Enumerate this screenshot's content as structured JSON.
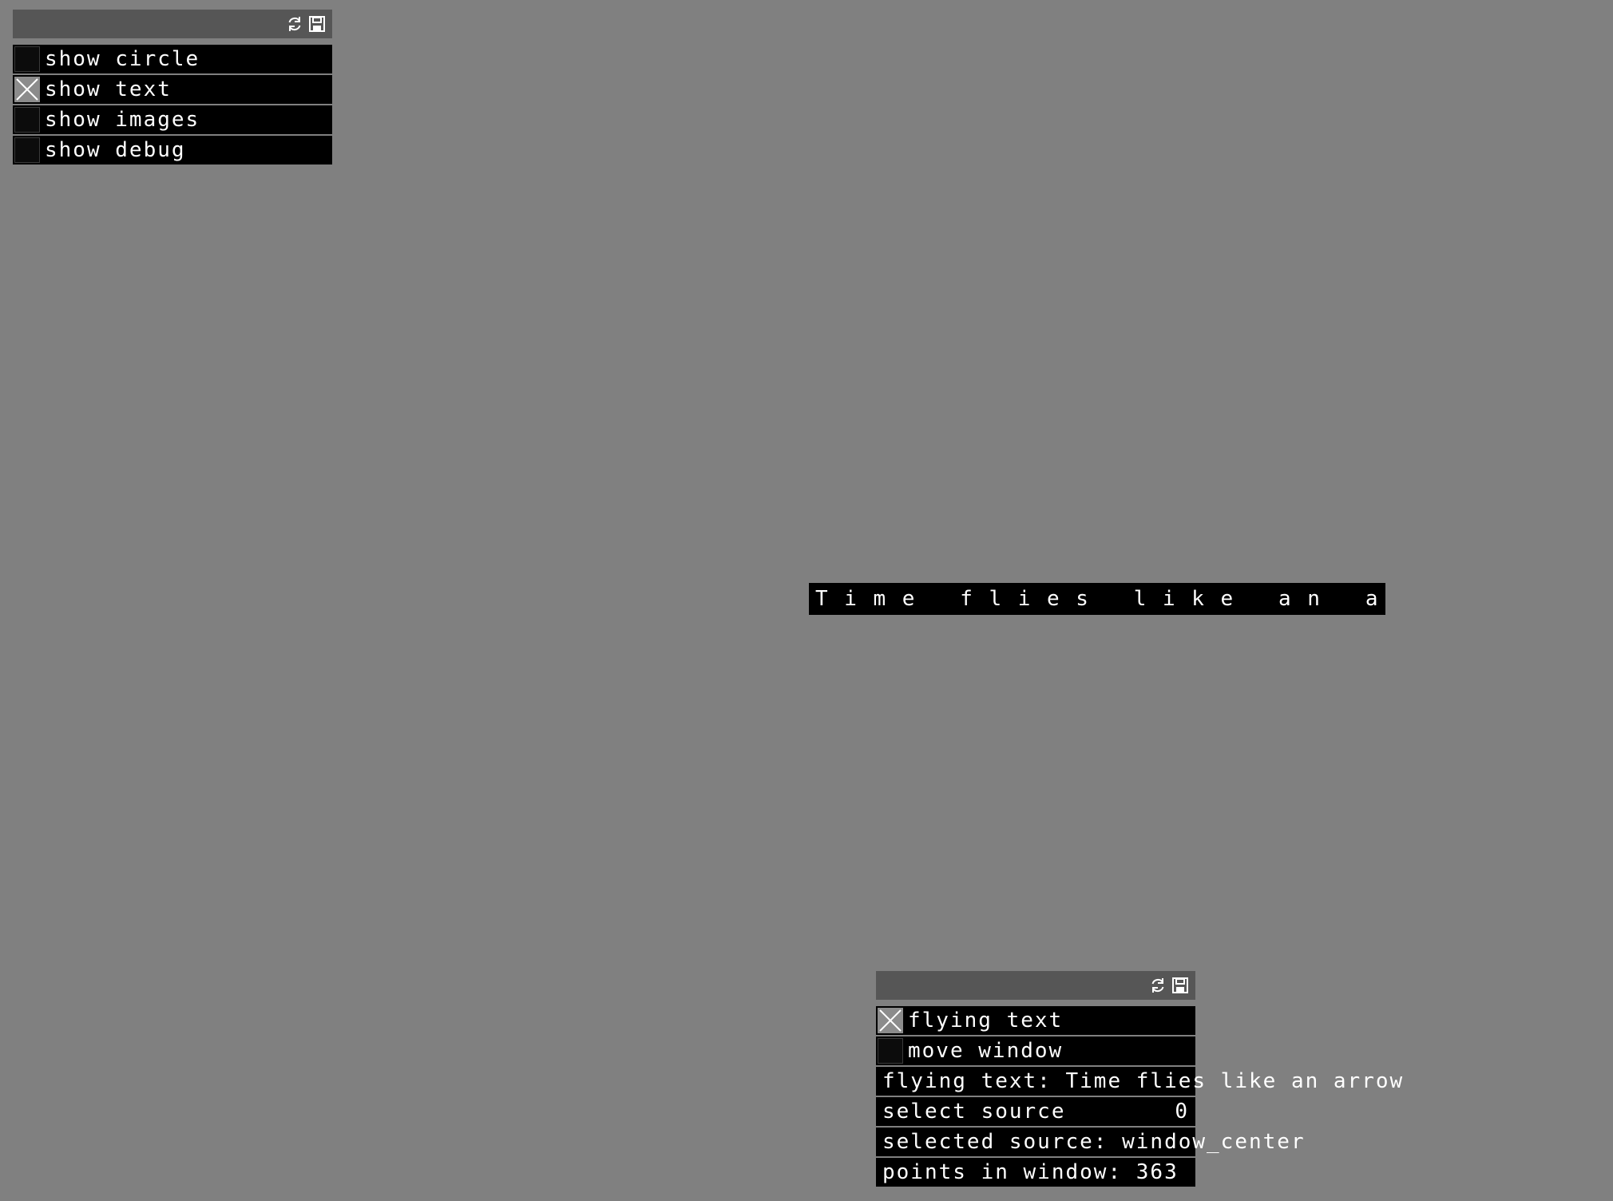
{
  "panels": {
    "main": {
      "toggles": [
        {
          "label": "show circle",
          "checked": false
        },
        {
          "label": "show text",
          "checked": true
        },
        {
          "label": "show images",
          "checked": false
        },
        {
          "label": "show debug",
          "checked": false
        }
      ],
      "icons": [
        "refresh-icon",
        "save-icon"
      ]
    },
    "flying": {
      "toggles": [
        {
          "label": "flying text",
          "checked": true
        },
        {
          "label": "move window",
          "checked": false
        }
      ],
      "text_field": {
        "label": "flying text: Time flies like an arrow"
      },
      "source_slider": {
        "label": "select source",
        "value": "0"
      },
      "selected_source": {
        "label": "selected source: window_center"
      },
      "points_readout": {
        "label": "points in window: 363"
      },
      "icons": [
        "refresh-icon",
        "save-icon"
      ]
    }
  },
  "flying_text_display": "Time flies like an arrow",
  "colors": {
    "background": "#808080",
    "panel_header": "#565656",
    "row": "#000000",
    "text": "#ffffff",
    "checkbox_checked": "#8c8c8c"
  }
}
